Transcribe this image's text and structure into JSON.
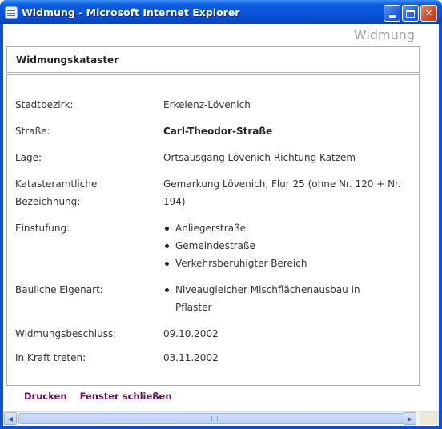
{
  "window": {
    "title": "Widmung - Microsoft Internet Explorer",
    "buttons": {
      "minimize": "minimize",
      "maximize": "maximize",
      "close": "✕"
    }
  },
  "page": {
    "heading": "Widmung",
    "section_title": "Widmungskataster",
    "fields": {
      "stadtbezirk": {
        "label": "Stadtbezirk:",
        "value": "Erkelenz-Lövenich"
      },
      "strasse": {
        "label": "Straße:",
        "value": "Carl-Theodor-Straße"
      },
      "lage": {
        "label": "Lage:",
        "value": "Ortsausgang Lövenich Richtung Katzem"
      },
      "kataster": {
        "label": "Katasteramtliche Bezeichnung:",
        "value": "Gemarkung Lövenich, Flur 25 (ohne Nr. 120 + Nr. 194)"
      },
      "einstufung": {
        "label": "Einstufung:",
        "items": [
          "Anliegerstraße",
          "Gemeindestraße",
          "Verkehrsberuhigter Bereich"
        ]
      },
      "bauliche_eigenart": {
        "label": "Bauliche Eigenart:",
        "items": [
          "Niveaugleicher Mischflächenausbau in Pflaster"
        ]
      },
      "widmungsbeschluss": {
        "label": "Widmungsbeschluss:",
        "value": "09.10.2002"
      },
      "in_kraft": {
        "label": "In Kraft treten:",
        "value": "03.11.2002"
      }
    },
    "links": {
      "print": "Drucken",
      "close": "Fenster schließen"
    }
  },
  "scrollbar": {
    "left_arrow": "◀",
    "right_arrow": "▶"
  },
  "colors": {
    "title_bar": "#0a53d6",
    "link": "#6a0a5a",
    "heading": "#a3a3a3"
  }
}
